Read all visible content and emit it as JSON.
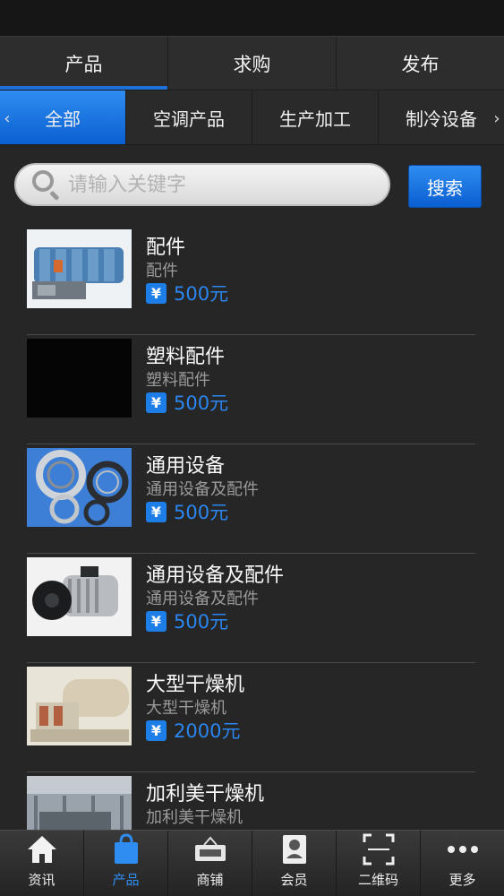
{
  "top_tabs": [
    {
      "label": "产品",
      "active": true
    },
    {
      "label": "求购",
      "active": false
    },
    {
      "label": "发布",
      "active": false
    }
  ],
  "categories": {
    "left_arrow": "‹",
    "right_arrow": "›",
    "items": [
      {
        "label": "全部",
        "active": true
      },
      {
        "label": "空调产品",
        "active": false
      },
      {
        "label": "生产加工",
        "active": false
      },
      {
        "label": "制冷设备",
        "active": false
      }
    ]
  },
  "search": {
    "placeholder": "请输入关键字",
    "value": "",
    "button_label": "搜索"
  },
  "products": [
    {
      "title": "配件",
      "subtitle": "配件",
      "price": "500元",
      "image": "industrial-dryer"
    },
    {
      "title": "塑料配件",
      "subtitle": "塑料配件",
      "price": "500元",
      "image": "black-placeholder"
    },
    {
      "title": "通用设备",
      "subtitle": "通用设备及配件",
      "price": "500元",
      "image": "bearings"
    },
    {
      "title": "通用设备及配件",
      "subtitle": "通用设备及配件",
      "price": "500元",
      "image": "motor"
    },
    {
      "title": "大型干燥机",
      "subtitle": "大型干燥机",
      "price": "2000元",
      "image": "drum-dryer"
    },
    {
      "title": "加利美干燥机",
      "subtitle": "加利美干燥机",
      "price": "",
      "image": "factory-hall"
    }
  ],
  "price_symbol": "¥",
  "bottom_nav": [
    {
      "label": "资讯",
      "icon": "home-icon",
      "active": false
    },
    {
      "label": "产品",
      "icon": "shopping-bag-icon",
      "active": true
    },
    {
      "label": "商铺",
      "icon": "open-sign-icon",
      "active": false
    },
    {
      "label": "会员",
      "icon": "member-card-icon",
      "active": false
    },
    {
      "label": "二维码",
      "icon": "qr-scan-icon",
      "active": false
    },
    {
      "label": "更多",
      "icon": "more-dots-icon",
      "active": false
    }
  ],
  "colors": {
    "accent": "#1f6fd8",
    "price": "#2b86f0",
    "background": "#262626"
  }
}
